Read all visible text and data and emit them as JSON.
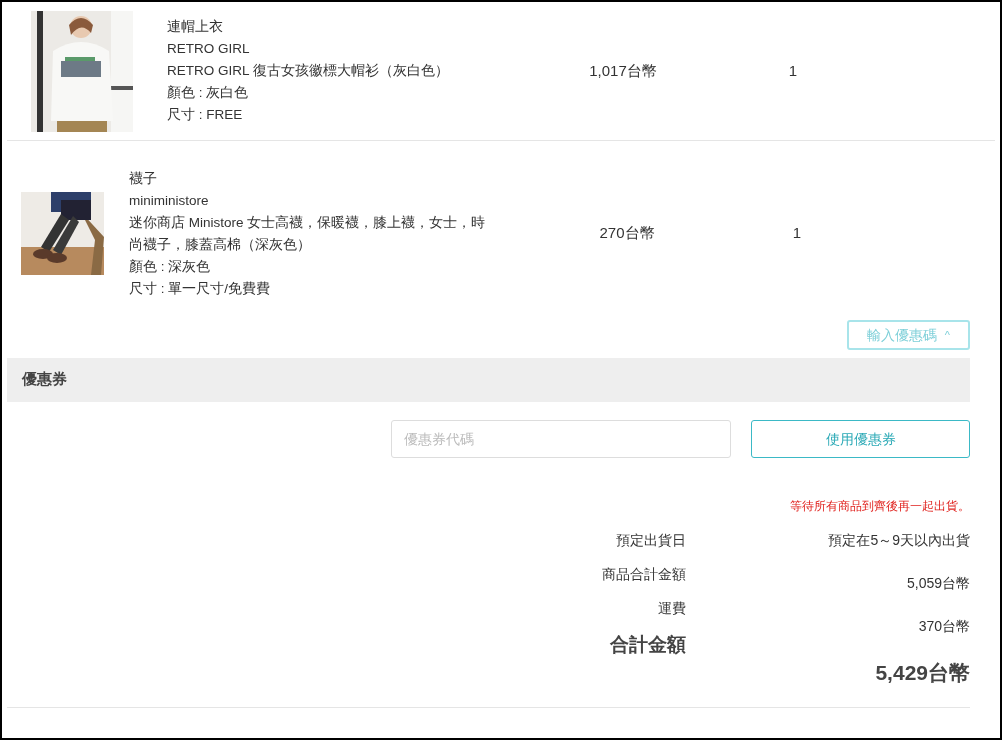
{
  "items": [
    {
      "category": "連帽上衣",
      "brand": "RETRO GIRL",
      "name": "RETRO GIRL 復古女孩徽標大帽衫（灰白色）",
      "variant": "顏色 : 灰白色",
      "size": "尺寸 : FREE",
      "price": "1,017台幣",
      "quantity": "1",
      "kind": "wide"
    },
    {
      "category": "襪子",
      "brand": "miniministore",
      "name": "迷你商店 Ministore 女士高襪，保暖襪，膝上襪，女士，時尚襪子，膝蓋高棉（深灰色）",
      "variant": "顏色 : 深灰色",
      "size": "尺寸 : 單一尺寸/免費費",
      "price": "270台幣",
      "quantity": "1",
      "kind": "compact"
    }
  ],
  "coupon_toggle": {
    "label": "輸入優惠碼",
    "caret": "^",
    "expanded": true
  },
  "coupon_section": {
    "title": "優惠券",
    "placeholder": "優惠券代碼",
    "button": "使用優惠券"
  },
  "shipping_notice": "等待所有商品到齊後再一起出貨。",
  "summary": {
    "labels": [
      "預定出貨日",
      "商品合計金額",
      "運費"
    ],
    "values": [
      "預定在5～9天以內出貨",
      "5,059台幣",
      "370台幣"
    ],
    "total_label": "合計金額",
    "total_value": "5,429台幣"
  }
}
